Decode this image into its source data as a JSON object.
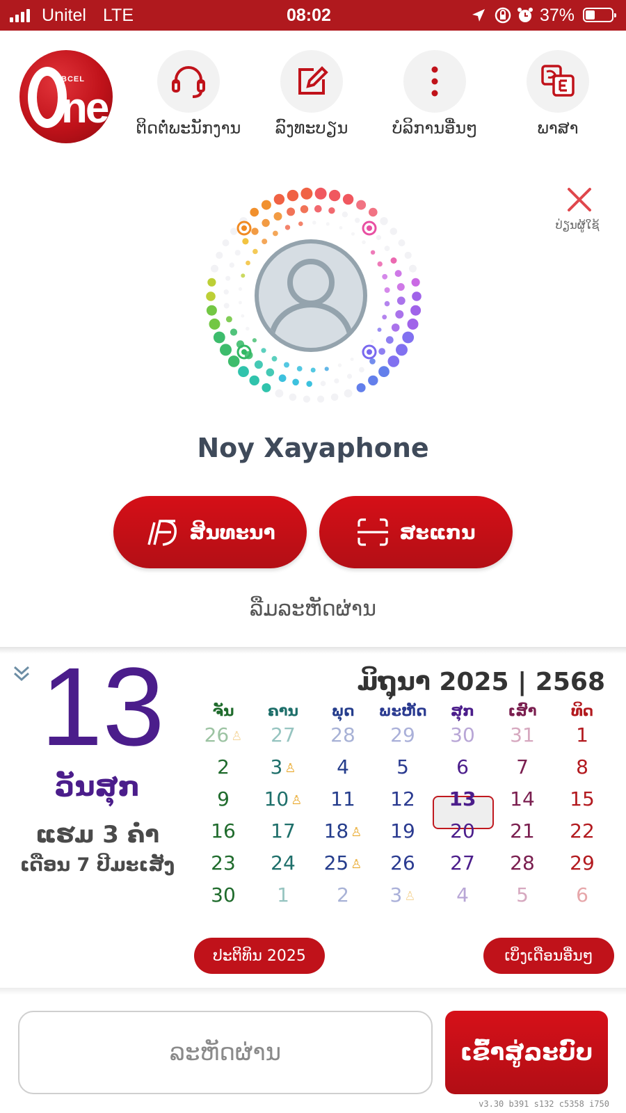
{
  "status_bar": {
    "carrier": "Unitel",
    "network": "LTE",
    "time": "08:02",
    "battery": "37%"
  },
  "app": {
    "logo_text": "ne",
    "logo_brand": "BCEL"
  },
  "quick_actions": [
    {
      "label": "ຕິດຕໍ່ພະນັກງານ",
      "icon": "headset-icon"
    },
    {
      "label": "ລົງທະບຽນ",
      "icon": "edit-icon"
    },
    {
      "label": "ບໍລິການອື່ນໆ",
      "icon": "more-vertical-icon"
    },
    {
      "label": "ພາສາ",
      "icon": "language-icon"
    }
  ],
  "profile": {
    "reset_label": "ປ່ຽນຜູ້ໃຊ້",
    "name": "Noy Xayaphone"
  },
  "actions": {
    "promo_label": "ສິນທະນາ",
    "scan_label": "ສະແກນ"
  },
  "forgot_password": "ລືມລະຫັດຜ່ານ",
  "calendar": {
    "day_number": "13",
    "weekday_name": "ວັນສຸກ",
    "lunar_line1": "ແຮມ 3 ຄ່ຳ",
    "lunar_line2": "ເດືອນ 7 ປີມະເສັງ",
    "month_title": "ມິຖຸນາ 2025 | 2568",
    "weekdays": [
      "ຈັນ",
      "ຄານ",
      "ພຸດ",
      "ພະຫັດ",
      "ສຸກ",
      "ເສົາ",
      "ທິດ"
    ],
    "weeks": [
      [
        {
          "d": "26",
          "o": true,
          "m": true
        },
        {
          "d": "27",
          "o": true
        },
        {
          "d": "28",
          "o": true
        },
        {
          "d": "29",
          "o": true
        },
        {
          "d": "30",
          "o": true
        },
        {
          "d": "31",
          "o": true
        },
        {
          "d": "1"
        }
      ],
      [
        {
          "d": "2"
        },
        {
          "d": "3",
          "m": true
        },
        {
          "d": "4"
        },
        {
          "d": "5"
        },
        {
          "d": "6"
        },
        {
          "d": "7"
        },
        {
          "d": "8"
        }
      ],
      [
        {
          "d": "9"
        },
        {
          "d": "10",
          "m": true
        },
        {
          "d": "11"
        },
        {
          "d": "12"
        },
        {
          "d": "13",
          "today": true
        },
        {
          "d": "14"
        },
        {
          "d": "15"
        }
      ],
      [
        {
          "d": "16"
        },
        {
          "d": "17"
        },
        {
          "d": "18",
          "m": true
        },
        {
          "d": "19"
        },
        {
          "d": "20"
        },
        {
          "d": "21"
        },
        {
          "d": "22"
        }
      ],
      [
        {
          "d": "23"
        },
        {
          "d": "24"
        },
        {
          "d": "25",
          "m": true
        },
        {
          "d": "26"
        },
        {
          "d": "27"
        },
        {
          "d": "28"
        },
        {
          "d": "29"
        }
      ],
      [
        {
          "d": "30"
        },
        {
          "d": "1",
          "o": true
        },
        {
          "d": "2",
          "o": true
        },
        {
          "d": "3",
          "o": true,
          "m": true
        },
        {
          "d": "4",
          "o": true
        },
        {
          "d": "5",
          "o": true
        },
        {
          "d": "6",
          "o": true
        }
      ]
    ],
    "col_colors": [
      "#1f6b2c",
      "#1e6f6a",
      "#253d8c",
      "#2a3a90",
      "#4b1d8b",
      "#7a1e4f",
      "#b31a1f"
    ],
    "muted_colors": [
      "#9cc3a2",
      "#96c4c0",
      "#a8b2d6",
      "#aab0d9",
      "#b8a6d6",
      "#d6a8bf",
      "#e6a6a9"
    ],
    "monk_icon": "buddhist-day-icon",
    "year_button": "ປະຕິທິນ 2025",
    "other_months_button": "ເບິ່ງເດືອນອື່ນໆ"
  },
  "login": {
    "password_placeholder": "ລະຫັດຜ່ານ",
    "login_label": "ເຂົ້າສູ່ລະບົບ"
  },
  "version": "v3.30 b391 s132 c5358 i750",
  "colors": {
    "brand_red": "#c0121a",
    "purple": "#4b1d8b"
  }
}
